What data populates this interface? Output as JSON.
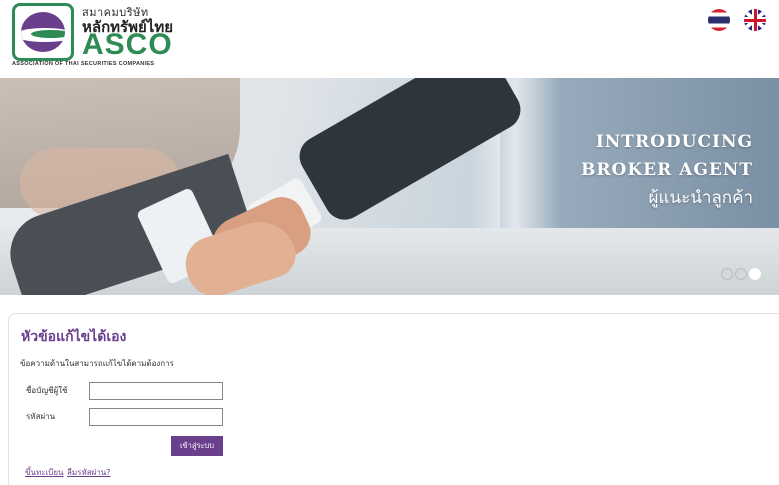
{
  "header": {
    "logo": {
      "line1": "สมาคมบริษัท",
      "line2": "หลักทรัพย์ไทย",
      "line3": "ASCO",
      "subtitle": "ASSOCIATION OF THAI SECURITIES COMPANIES"
    },
    "languages": [
      {
        "icon": "thai-flag-icon",
        "name": "Thai"
      },
      {
        "icon": "uk-flag-icon",
        "name": "English"
      }
    ]
  },
  "banner": {
    "title_line1": "INTRODUCING",
    "title_line2": "BROKER AGENT",
    "subtitle": "ผู้แนะนำลูกค้า",
    "slides": 3,
    "active_slide": 3
  },
  "login": {
    "title": "หัวข้อแก้ไขได้เอง",
    "description": "ข้อความด้านในสามารถแก้ไขได้ตามต้องการ",
    "username_label": "ชื่อบัญชีผู้ใช้",
    "username_value": "",
    "password_label": "รหัสผ่าน",
    "password_value": "",
    "submit_label": "เข้าสู่ระบบ",
    "register_link": "ขึ้นทะเบียน",
    "forgot_link": "ลืมรหัสผ่าน?"
  },
  "colors": {
    "brand_purple": "#6a3f8c",
    "brand_green": "#2e8b55"
  }
}
